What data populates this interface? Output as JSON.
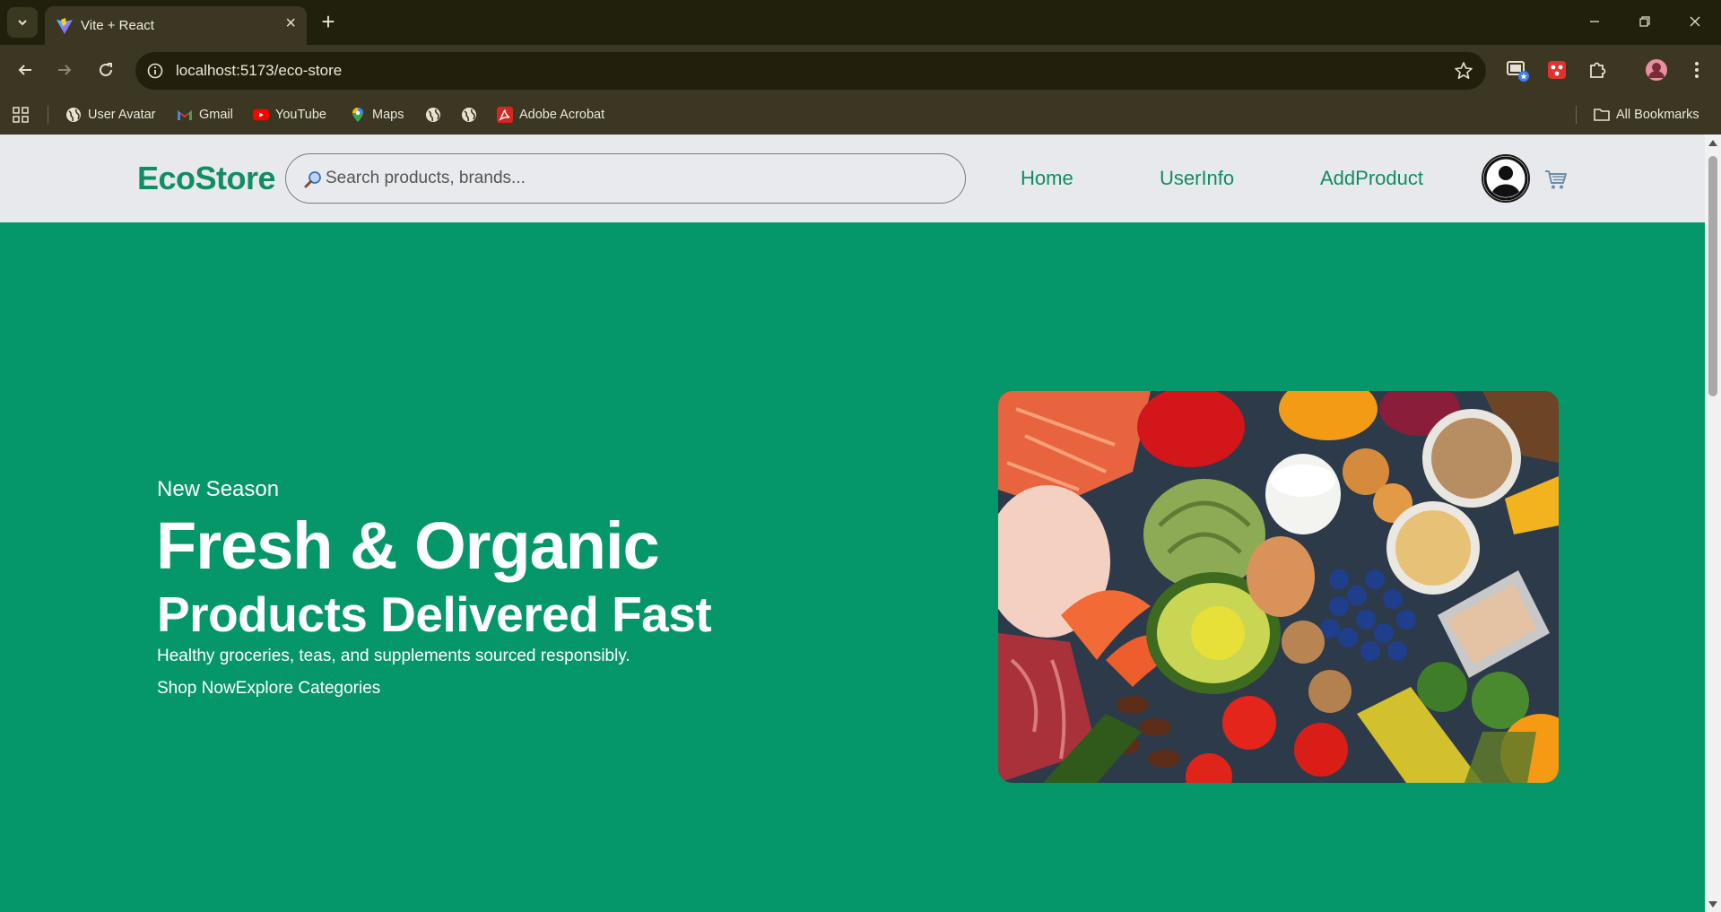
{
  "browser": {
    "tab": {
      "title": "Vite + React",
      "favicon": "vite-logo-icon"
    },
    "url": "localhost:5173/eco-store",
    "bookmarks": [
      {
        "label": "User Avatar",
        "icon": "globe-icon"
      },
      {
        "label": "Gmail",
        "icon": "gmail-icon"
      },
      {
        "label": "YouTube",
        "icon": "youtube-icon"
      },
      {
        "label": "Maps",
        "icon": "maps-icon"
      },
      {
        "label": "",
        "icon": "globe-icon"
      },
      {
        "label": "",
        "icon": "globe-icon"
      },
      {
        "label": "Adobe Acrobat",
        "icon": "acrobat-icon"
      }
    ],
    "all_bookmarks": "All Bookmarks"
  },
  "site": {
    "logo": "EcoStore",
    "search_placeholder": "Search products, brands...",
    "nav": [
      "Home",
      "UserInfo",
      "AddProduct"
    ],
    "colors": {
      "brand": "#0f8d63",
      "hero_bg": "#05976a",
      "header_bg": "#e8e9ec"
    }
  },
  "hero": {
    "tag": "New Season",
    "heading1": "Fresh & Organic",
    "heading2": "Products Delivered Fast",
    "description": "Healthy groceries, teas, and supplements sourced responsibly.",
    "cta_primary": "Shop Now",
    "cta_secondary": "Explore Categories"
  }
}
